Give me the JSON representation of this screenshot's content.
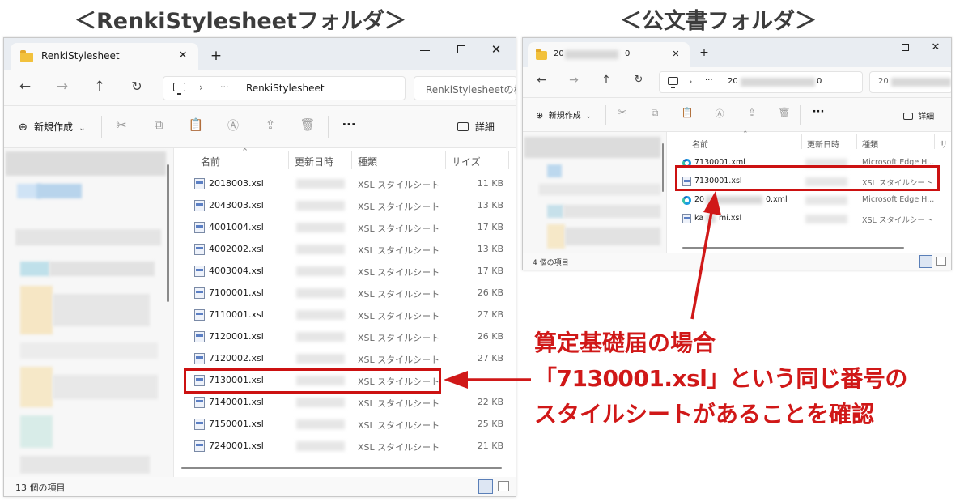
{
  "headings": {
    "left": "＜RenkiStylesheetフォルダ＞",
    "right": "＜公文書フォルダ＞"
  },
  "left_window": {
    "tab_title": "RenkiStylesheet",
    "tab_close": "✕",
    "new_tab": "+",
    "window_controls": {
      "minimize": "—",
      "maximize": "□",
      "close": "✕"
    },
    "nav": {
      "back": "←",
      "forward": "→",
      "up": "↑",
      "refresh": "↻"
    },
    "address": {
      "separator": "›",
      "ellipsis": "···",
      "folder": "RenkiStylesheet"
    },
    "search_placeholder": "RenkiStylesheetの検",
    "toolbar": {
      "new_label": "新規作成",
      "new_icon": "⊕",
      "chevron": "⌄",
      "more": "···",
      "details_label": "詳細"
    },
    "columns": {
      "name": "名前",
      "modified": "更新日時",
      "type": "種類",
      "size": "サイズ",
      "sort_arrow": "⌃"
    },
    "files": [
      {
        "name": "2018003.xsl",
        "type": "XSL スタイルシート",
        "size": "11 KB"
      },
      {
        "name": "2043003.xsl",
        "type": "XSL スタイルシート",
        "size": "13 KB"
      },
      {
        "name": "4001004.xsl",
        "type": "XSL スタイルシート",
        "size": "17 KB"
      },
      {
        "name": "4002002.xsl",
        "type": "XSL スタイルシート",
        "size": "13 KB"
      },
      {
        "name": "4003004.xsl",
        "type": "XSL スタイルシート",
        "size": "17 KB"
      },
      {
        "name": "7100001.xsl",
        "type": "XSL スタイルシート",
        "size": "26 KB"
      },
      {
        "name": "7110001.xsl",
        "type": "XSL スタイルシート",
        "size": "27 KB"
      },
      {
        "name": "7120001.xsl",
        "type": "XSL スタイルシート",
        "size": "26 KB"
      },
      {
        "name": "7120002.xsl",
        "type": "XSL スタイルシート",
        "size": "27 KB"
      },
      {
        "name": "7130001.xsl",
        "type": "XSL スタイルシート",
        "size": ""
      },
      {
        "name": "7140001.xsl",
        "type": "XSL スタイルシート",
        "size": "22 KB"
      },
      {
        "name": "7150001.xsl",
        "type": "XSL スタイルシート",
        "size": "25 KB"
      },
      {
        "name": "7240001.xsl",
        "type": "XSL スタイルシート",
        "size": "21 KB"
      }
    ],
    "status": "13 個の項目"
  },
  "right_window": {
    "tab_title": "20",
    "tab_title_end": "0",
    "tab_close": "✕",
    "new_tab": "+",
    "window_controls": {
      "minimize": "—",
      "maximize": "□",
      "close": "✕"
    },
    "nav": {
      "back": "←",
      "forward": "→",
      "up": "↑",
      "refresh": "↻"
    },
    "address": {
      "separator": "›",
      "ellipsis": "···",
      "folder_start": "20",
      "folder_end": "0"
    },
    "search_placeholder": "20",
    "toolbar": {
      "new_label": "新規作成",
      "new_icon": "⊕",
      "chevron": "⌄",
      "more": "···",
      "details_label": "詳細"
    },
    "columns": {
      "name": "名前",
      "modified": "更新日時",
      "type": "種類",
      "size": "サ",
      "sort_arrow": "⌃"
    },
    "files": [
      {
        "name": "7130001.xml",
        "type": "Microsoft Edge H...",
        "icon": "edge-icon"
      },
      {
        "name": "7130001.xsl",
        "type": "XSL スタイルシート",
        "icon": "xsl-icon"
      },
      {
        "name": "20",
        "name_end": "0.xml",
        "type": "Microsoft Edge H...",
        "icon": "edge-icon"
      },
      {
        "name": "ka",
        "name_end": "mi.xsl",
        "type": "XSL スタイルシート",
        "icon": "xsl-icon"
      }
    ],
    "status": "4 個の項目"
  },
  "annotation": {
    "line1": "算定基礎届の場合",
    "line2": "「7130001.xsl」という同じ番号の",
    "line3": "スタイルシートがあることを確認",
    "color": "#d01818"
  },
  "colors": {
    "highlight_box": "#cc1111",
    "folder_icon": "#f2c13c",
    "titlebar": "#e9edf2"
  }
}
